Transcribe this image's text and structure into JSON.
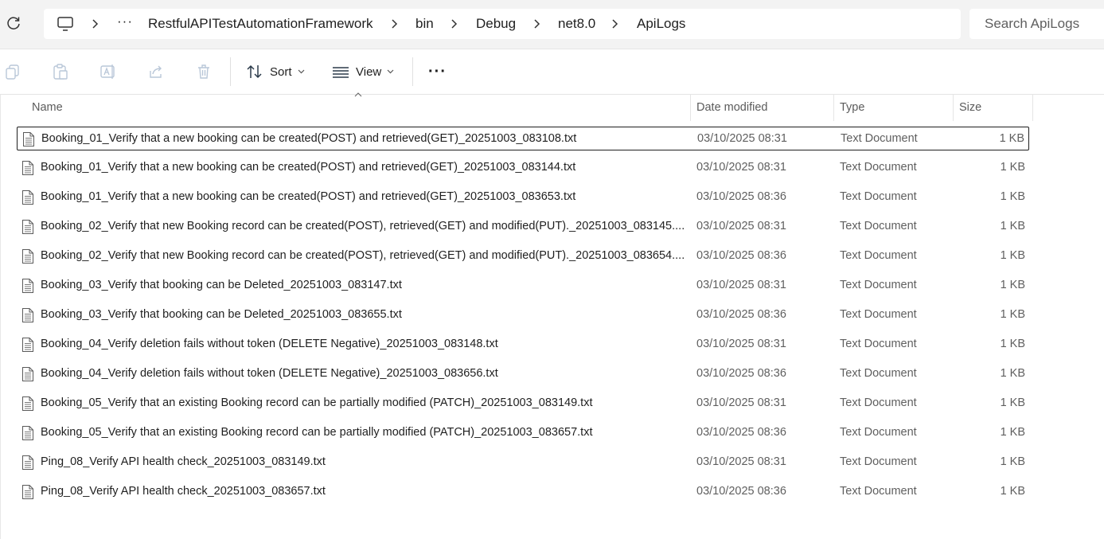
{
  "address_bar": {
    "overflow": "···",
    "breadcrumbs": [
      "RestfulAPITestAutomationFramework",
      "bin",
      "Debug",
      "net8.0",
      "ApiLogs"
    ]
  },
  "search": {
    "placeholder": "Search ApiLogs"
  },
  "toolbar": {
    "sort_label": "Sort",
    "view_label": "View",
    "more_label": "···"
  },
  "columns": {
    "name": "Name",
    "date": "Date modified",
    "type": "Type",
    "size": "Size"
  },
  "files": [
    {
      "name": "Booking_01_Verify that a new booking can be created(POST) and retrieved(GET)_20251003_083108.txt",
      "date": "03/10/2025 08:31",
      "type": "Text Document",
      "size": "1 KB",
      "selected": true
    },
    {
      "name": "Booking_01_Verify that a new booking can be created(POST) and retrieved(GET)_20251003_083144.txt",
      "date": "03/10/2025 08:31",
      "type": "Text Document",
      "size": "1 KB"
    },
    {
      "name": "Booking_01_Verify that a new booking can be created(POST) and retrieved(GET)_20251003_083653.txt",
      "date": "03/10/2025 08:36",
      "type": "Text Document",
      "size": "1 KB"
    },
    {
      "name": "Booking_02_Verify that new Booking record can be created(POST), retrieved(GET) and modified(PUT)._20251003_083145....",
      "date": "03/10/2025 08:31",
      "type": "Text Document",
      "size": "1 KB"
    },
    {
      "name": "Booking_02_Verify that new Booking record can be created(POST), retrieved(GET) and modified(PUT)._20251003_083654....",
      "date": "03/10/2025 08:36",
      "type": "Text Document",
      "size": "1 KB"
    },
    {
      "name": "Booking_03_Verify that booking can be Deleted_20251003_083147.txt",
      "date": "03/10/2025 08:31",
      "type": "Text Document",
      "size": "1 KB"
    },
    {
      "name": "Booking_03_Verify that booking can be Deleted_20251003_083655.txt",
      "date": "03/10/2025 08:36",
      "type": "Text Document",
      "size": "1 KB"
    },
    {
      "name": "Booking_04_Verify deletion fails without token (DELETE Negative)_20251003_083148.txt",
      "date": "03/10/2025 08:31",
      "type": "Text Document",
      "size": "1 KB"
    },
    {
      "name": "Booking_04_Verify deletion fails without token (DELETE Negative)_20251003_083656.txt",
      "date": "03/10/2025 08:36",
      "type": "Text Document",
      "size": "1 KB"
    },
    {
      "name": "Booking_05_Verify that an existing Booking record can be partially modified (PATCH)_20251003_083149.txt",
      "date": "03/10/2025 08:31",
      "type": "Text Document",
      "size": "1 KB"
    },
    {
      "name": "Booking_05_Verify that an existing Booking record can be partially modified (PATCH)_20251003_083657.txt",
      "date": "03/10/2025 08:36",
      "type": "Text Document",
      "size": "1 KB"
    },
    {
      "name": "Ping_08_Verify API health check_20251003_083149.txt",
      "date": "03/10/2025 08:31",
      "type": "Text Document",
      "size": "1 KB"
    },
    {
      "name": "Ping_08_Verify API health check_20251003_083657.txt",
      "date": "03/10/2025 08:36",
      "type": "Text Document",
      "size": "1 KB"
    }
  ],
  "icons": {
    "refresh": "refresh-icon",
    "computer": "monitor-icon",
    "copy": "copy-icon",
    "paste": "paste-icon",
    "rename": "rename-icon",
    "share": "share-icon",
    "delete": "delete-icon",
    "sort": "sort-icon",
    "view": "view-icon",
    "file": "text-file-icon"
  }
}
